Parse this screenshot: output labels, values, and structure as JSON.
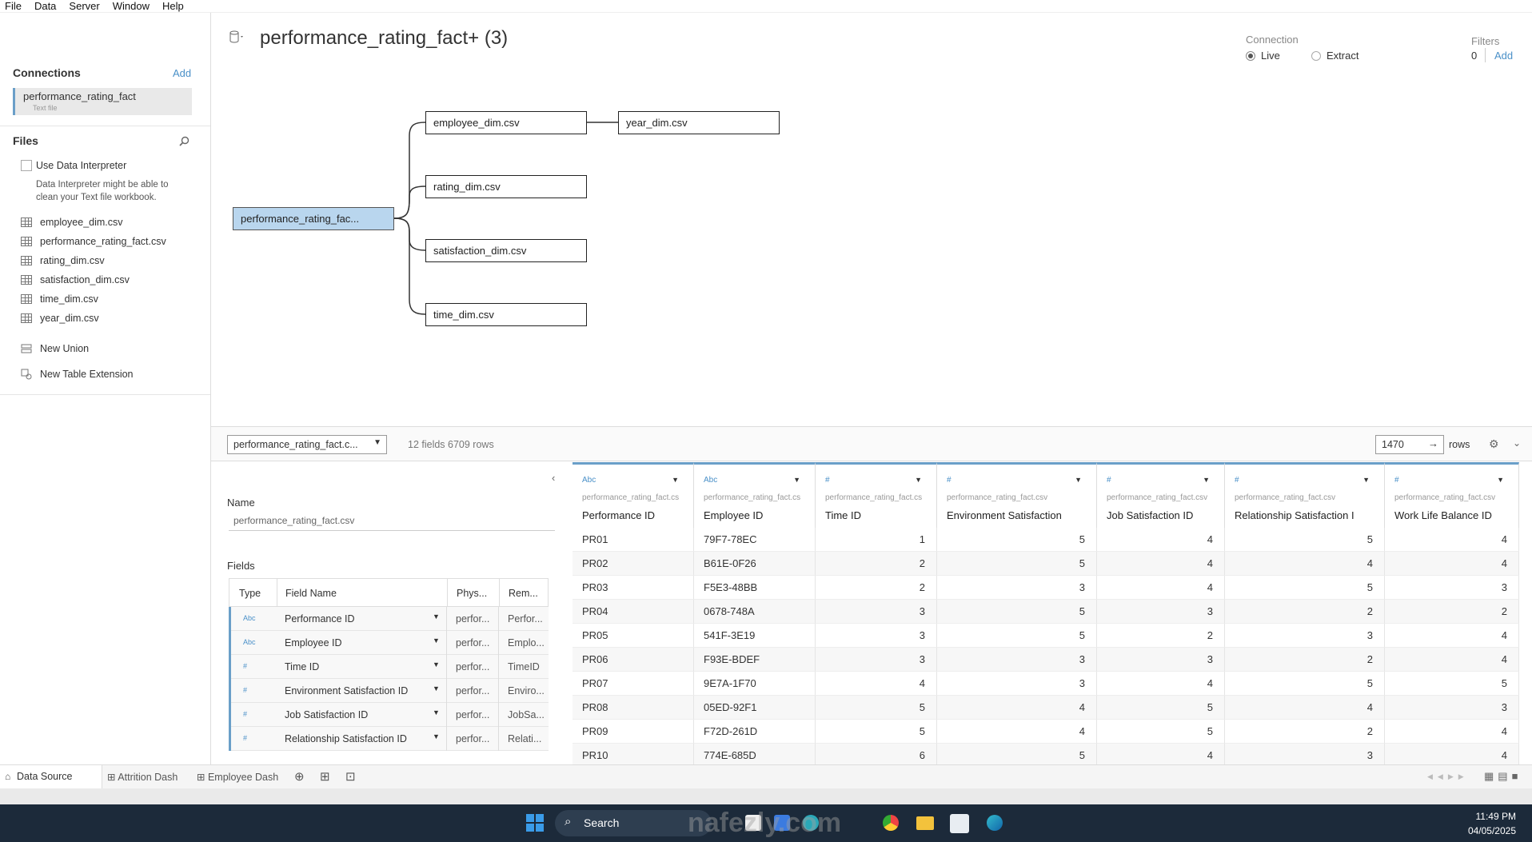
{
  "menu": [
    "File",
    "Data",
    "Server",
    "Window",
    "Help"
  ],
  "connections": {
    "title": "Connections",
    "add_label": "Add",
    "item_name": "performance_rating_fact",
    "item_sub": "Text file"
  },
  "files": {
    "title": "Files",
    "interpreter_label": "Use Data Interpreter",
    "interpreter_note": "Data Interpreter might be able to clean your Text file workbook.",
    "items": [
      "employee_dim.csv",
      "performance_rating_fact.csv",
      "rating_dim.csv",
      "satisfaction_dim.csv",
      "time_dim.csv",
      "year_dim.csv"
    ],
    "new_union": "New Union",
    "new_table_extension": "New Table Extension"
  },
  "canvas": {
    "title": "performance_rating_fact+ (3)",
    "root_table": "performance_rating_fac...",
    "tables": [
      "employee_dim.csv",
      "rating_dim.csv",
      "satisfaction_dim.csv",
      "time_dim.csv"
    ],
    "secondary_table": "year_dim.csv"
  },
  "connection": {
    "label": "Connection",
    "live": "Live",
    "extract": "Extract",
    "live_selected": true
  },
  "filters": {
    "label": "Filters",
    "count": "0",
    "add_label": "Add"
  },
  "data_grid_bar": {
    "table_select": "performance_rating_fact.c...",
    "summary": "12 fields 6709 rows",
    "rows_value": "1470",
    "rows_label": "rows"
  },
  "metadata": {
    "name_label": "Name",
    "name_value": "performance_rating_fact.csv",
    "fields_label": "Fields",
    "columns": [
      "Type",
      "Field Name",
      "Phys...",
      "Rem..."
    ],
    "rows": [
      {
        "type": "Abc",
        "name": "Performance ID",
        "phys": "perfor...",
        "rem": "Perfor..."
      },
      {
        "type": "Abc",
        "name": "Employee ID",
        "phys": "perfor...",
        "rem": "Emplo..."
      },
      {
        "type": "#",
        "name": "Time ID",
        "phys": "perfor...",
        "rem": "TimeID"
      },
      {
        "type": "#",
        "name": "Environment Satisfaction ID",
        "phys": "perfor...",
        "rem": "Enviro..."
      },
      {
        "type": "#",
        "name": "Job Satisfaction ID",
        "phys": "perfor...",
        "rem": "JobSa..."
      },
      {
        "type": "#",
        "name": "Relationship Satisfaction ID",
        "phys": "perfor...",
        "rem": "Relati..."
      }
    ]
  },
  "grid": {
    "columns": [
      {
        "type": "Abc",
        "src": "performance_rating_fact.cs",
        "name": "Performance ID"
      },
      {
        "type": "Abc",
        "src": "performance_rating_fact.cs",
        "name": "Employee ID"
      },
      {
        "type": "#",
        "src": "performance_rating_fact.cs",
        "name": "Time ID"
      },
      {
        "type": "#",
        "src": "performance_rating_fact.csv",
        "name": "Environment Satisfaction"
      },
      {
        "type": "#",
        "src": "performance_rating_fact.csv",
        "name": "Job Satisfaction ID"
      },
      {
        "type": "#",
        "src": "performance_rating_fact.csv",
        "name": "Relationship Satisfaction I"
      },
      {
        "type": "#",
        "src": "performance_rating_fact.csv",
        "name": "Work Life Balance ID"
      }
    ],
    "rows": [
      [
        "PR01",
        "79F7-78EC",
        "1",
        "5",
        "4",
        "5",
        "4"
      ],
      [
        "PR02",
        "B61E-0F26",
        "2",
        "5",
        "4",
        "4",
        "4"
      ],
      [
        "PR03",
        "F5E3-48BB",
        "2",
        "3",
        "4",
        "5",
        "3"
      ],
      [
        "PR04",
        "0678-748A",
        "3",
        "5",
        "3",
        "2",
        "2"
      ],
      [
        "PR05",
        "541F-3E19",
        "3",
        "5",
        "2",
        "3",
        "4"
      ],
      [
        "PR06",
        "F93E-BDEF",
        "3",
        "3",
        "3",
        "2",
        "4"
      ],
      [
        "PR07",
        "9E7A-1F70",
        "4",
        "3",
        "4",
        "5",
        "5"
      ],
      [
        "PR08",
        "05ED-92F1",
        "5",
        "4",
        "5",
        "4",
        "3"
      ],
      [
        "PR09",
        "F72D-261D",
        "5",
        "4",
        "5",
        "2",
        "4"
      ],
      [
        "PR10",
        "774E-685D",
        "6",
        "5",
        "4",
        "3",
        "4"
      ]
    ]
  },
  "sheet_tabs": [
    "Data Source",
    "Attrition Dash",
    "Employee Dash"
  ],
  "taskbar": {
    "search_label": "Search",
    "time": "11:49 PM",
    "date": "04/05/2025"
  },
  "watermark": "nafezly.com"
}
